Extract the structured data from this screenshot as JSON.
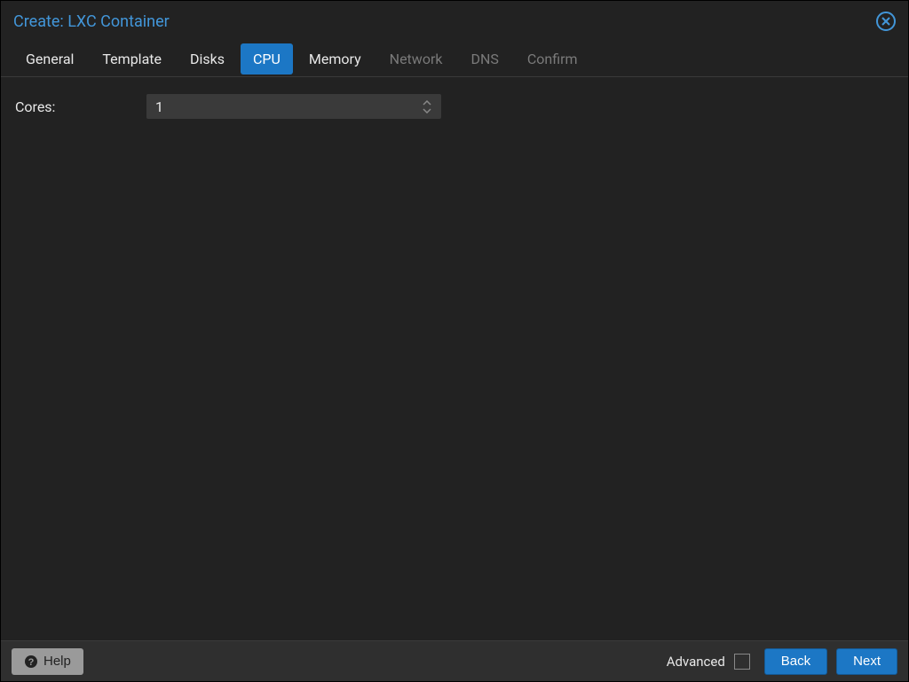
{
  "dialog": {
    "title": "Create: LXC Container"
  },
  "tabs": [
    {
      "label": "General",
      "active": false,
      "disabled": false
    },
    {
      "label": "Template",
      "active": false,
      "disabled": false
    },
    {
      "label": "Disks",
      "active": false,
      "disabled": false
    },
    {
      "label": "CPU",
      "active": true,
      "disabled": false
    },
    {
      "label": "Memory",
      "active": false,
      "disabled": false
    },
    {
      "label": "Network",
      "active": false,
      "disabled": true
    },
    {
      "label": "DNS",
      "active": false,
      "disabled": true
    },
    {
      "label": "Confirm",
      "active": false,
      "disabled": true
    }
  ],
  "form": {
    "cores": {
      "label": "Cores:",
      "value": "1"
    }
  },
  "footer": {
    "help_label": "Help",
    "advanced_label": "Advanced",
    "advanced_checked": false,
    "back_label": "Back",
    "next_label": "Next"
  }
}
